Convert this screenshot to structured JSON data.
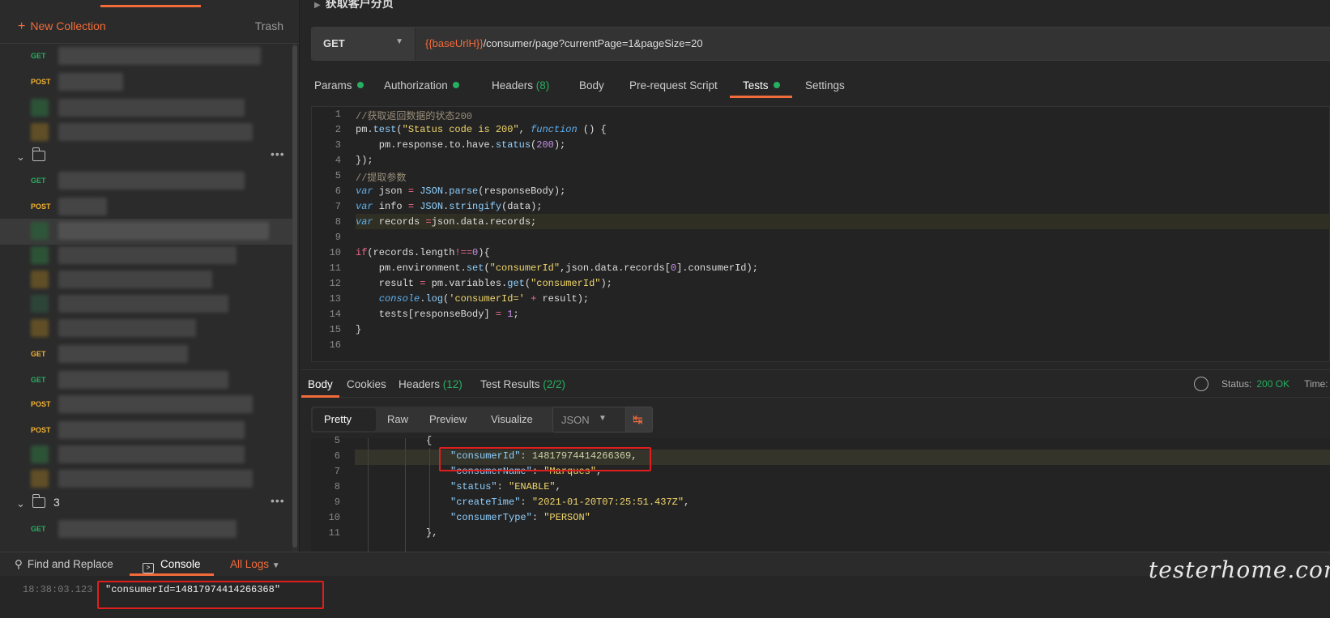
{
  "sidebar": {
    "new_collection": "New Collection",
    "trash": "Trash",
    "rows": [
      {
        "method": "GET"
      },
      {
        "method": "POST"
      },
      {
        "method": "GET"
      },
      {
        "method": "POST"
      },
      {
        "method": "GET"
      },
      {
        "method": "POST"
      },
      {
        "method": "POST"
      },
      {
        "method": "GET"
      },
      {
        "method": "GET"
      }
    ],
    "folder_3": "3",
    "folder_dots": "•••"
  },
  "request": {
    "title": "获取客户分页",
    "method": "GET",
    "url_var": "{{baseUrlH}}",
    "url_rest": "/consumer/page?currentPage=1&pageSize=20"
  },
  "req_tabs": {
    "params": "Params",
    "authorization": "Authorization",
    "headers": "Headers",
    "headers_count": "(8)",
    "body": "Body",
    "prerequest": "Pre-request Script",
    "tests": "Tests",
    "settings": "Settings"
  },
  "code_lines": [
    "1",
    "2",
    "3",
    "4",
    "5",
    "6",
    "7",
    "8",
    "9",
    "10",
    "11",
    "12",
    "13",
    "14",
    "15",
    "16"
  ],
  "resp_tabs": {
    "body": "Body",
    "cookies": "Cookies",
    "headers": "Headers",
    "headers_count": "(12)",
    "test_results": "Test Results",
    "test_count": "(2/2)",
    "status_label": "Status:",
    "status_value": "200 OK",
    "time_label": "Time:"
  },
  "view": {
    "pretty": "Pretty",
    "raw": "Raw",
    "preview": "Preview",
    "visualize": "Visualize",
    "format": "JSON"
  },
  "resp_lines": [
    "5",
    "6",
    "7",
    "8",
    "9",
    "10",
    "11"
  ],
  "response": {
    "consumerId": "14817974414266369",
    "consumerName": "\"Marques\"",
    "status": "\"ENABLE\"",
    "createTime": "\"2021-01-20T07:25:51.437Z\"",
    "consumerType": "\"PERSON\""
  },
  "bottom": {
    "find_replace": "Find and Replace",
    "console": "Console",
    "all_logs": "All Logs"
  },
  "console": {
    "timestamp": "18:38:03.123",
    "message": "\"consumerId=14817974414266368\""
  },
  "watermark": "testerhome.com"
}
